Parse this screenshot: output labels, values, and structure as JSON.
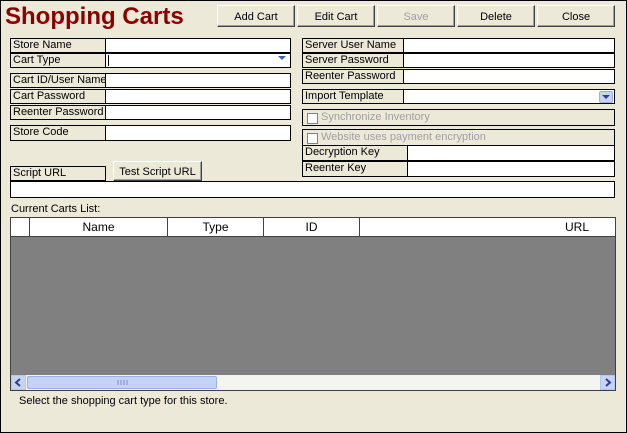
{
  "window": {
    "title": "Shopping Carts"
  },
  "toolbar": {
    "add": "Add Cart",
    "edit": "Edit Cart",
    "save": "Save",
    "delete": "Delete",
    "close": "Close"
  },
  "left": {
    "store_name": "Store Name",
    "cart_type": "Cart Type",
    "cart_id": "Cart ID/User Name",
    "cart_password": "Cart Password",
    "reenter_password": "Reenter Password",
    "store_code": "Store Code",
    "script_url": "Script URL",
    "test_script_url": "Test Script URL"
  },
  "right": {
    "server_user": "Server User Name",
    "server_password": "Server Password",
    "reenter_password": "Reenter Password",
    "import_template": "Import Template",
    "sync_inventory": "Synchronize Inventory",
    "payment_encryption": "Website uses payment encryption",
    "decryption_key": "Decryption Key",
    "reenter_key": "Reenter Key"
  },
  "list": {
    "label": "Current Carts List:",
    "columns": [
      "Name",
      "Type",
      "ID",
      "URL"
    ]
  },
  "status": {
    "text": "Select the shopping cart type for this store."
  },
  "colors": {
    "title": "#8B0000",
    "grid_bg": "#808080",
    "window_bg": "#ECE9D8"
  },
  "icons": {
    "dropdown": "chevron-down-icon",
    "scroll_left": "arrow-left-icon",
    "scroll_right": "arrow-right-icon"
  }
}
